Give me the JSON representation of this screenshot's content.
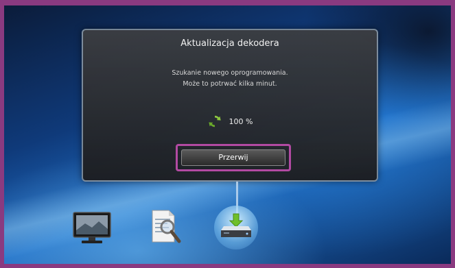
{
  "dialog": {
    "title": "Aktualizacja dekodera",
    "message_line1": "Szukanie nowego oprogramowania.",
    "message_line2": "Może to potrwać kilka minut.",
    "progress_text": "100 %",
    "progress_value": 100,
    "cancel_button": "Przerwij"
  },
  "icons": {
    "dialog_icon": "refresh-icon",
    "bottom": [
      "tv-icon",
      "document-search-icon",
      "set-top-box-download-icon"
    ]
  },
  "colors": {
    "highlight": "#b24aa2",
    "frame": "#8a3a80",
    "refresh_icon": "#8cc63f"
  }
}
